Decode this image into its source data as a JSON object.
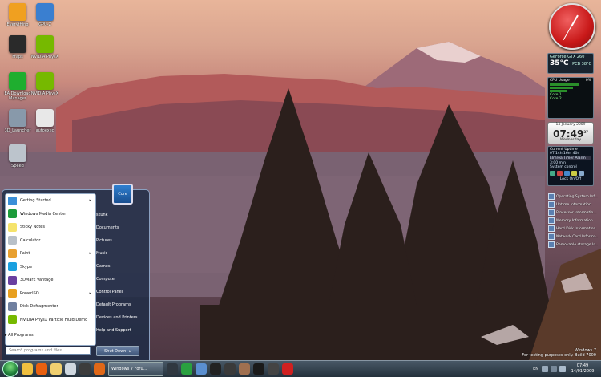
{
  "desktop_icons": [
    {
      "label": "Everything",
      "color": "#f0a020",
      "icon": "orange-menu-icon"
    },
    {
      "label": "GPU-Z",
      "color": "#3a7fd0",
      "icon": "gpu-chip-icon"
    },
    {
      "label": "Fraps",
      "color": "#2a2a2a",
      "icon": "fraps-icon"
    },
    {
      "label": "NVIDIA PhysX",
      "color": "#76b900",
      "icon": "nvidia-icon"
    },
    {
      "label": "EA Download Manager",
      "color": "#1fae2f",
      "icon": "ea-icon"
    },
    {
      "label": "NVIDIA PhysX",
      "color": "#76b900",
      "icon": "nvidia-icon"
    },
    {
      "label": "3D_Launcher",
      "color": "#8899aa",
      "icon": "launcher-icon"
    },
    {
      "label": "autoexec",
      "color": "#e8e8e8",
      "icon": "text-file-icon"
    },
    {
      "label": "Speed",
      "color": "#bcc4cc",
      "icon": "recycle-bin-icon"
    }
  ],
  "gadgets": {
    "gpu": {
      "name": "GeForce GTX 260",
      "temp": "35°C",
      "sub": "PCB 38°C"
    },
    "cpu": {
      "title": "CPU Usage",
      "value": "0%",
      "cores": [
        "Core 1",
        "Core 2"
      ]
    },
    "date": {
      "month": "14 January 2009",
      "time": "07:49",
      "seconds": "37",
      "day": "Wednesday"
    },
    "uptime": {
      "title": "Current Uptime",
      "value": "0T 14h 16m 40s",
      "tabs": "Elmrea  Timer  Alarm",
      "row": "3:00 min",
      "control": "System control",
      "footer": "Lock On/Off"
    },
    "sidebar": [
      "Operating System Inf...",
      "Uptime Information",
      "Processor Informatio...",
      "Memory Information",
      "Hard Disk Information",
      "Network Card Informa...",
      "Removable storage In..."
    ]
  },
  "start_menu": {
    "left_items": [
      {
        "label": "Getting Started",
        "color": "#3b8fd8",
        "arrow": true,
        "highlight": false
      },
      {
        "label": "Windows Media Center",
        "color": "#1c9b3a",
        "arrow": false,
        "highlight": false
      },
      {
        "label": "Sticky Notes",
        "color": "#f5e36c",
        "arrow": false,
        "highlight": false
      },
      {
        "label": "Calculator",
        "color": "#b8c0c8",
        "arrow": false,
        "highlight": false
      },
      {
        "label": "Paint",
        "color": "#e8a030",
        "arrow": true,
        "highlight": false
      },
      {
        "label": "Skype",
        "color": "#1aa0e0",
        "arrow": false,
        "highlight": false
      },
      {
        "label": "3DMark Vantage",
        "color": "#6a3fa0",
        "arrow": false,
        "highlight": false
      },
      {
        "label": "PowerISO",
        "color": "#e8a020",
        "arrow": true,
        "highlight": false
      },
      {
        "label": "Disk Defragmenter",
        "color": "#7080a0",
        "arrow": false,
        "highlight": false
      },
      {
        "label": "NVIDIA PhysX Particle Fluid Demo",
        "color": "#76b900",
        "arrow": false,
        "highlight": false
      }
    ],
    "all_programs": "All Programs",
    "search_placeholder": "Search programs and files",
    "right_items": [
      "skunk",
      "Documents",
      "Pictures",
      "Music",
      "Games",
      "Computer",
      "Control Panel",
      "Default Programs",
      "Devices and Printers",
      "Help and Support"
    ],
    "shutdown": "Shut Down",
    "user_pic": "Core"
  },
  "taskbar": {
    "window_button": "Windows 7 Foru...",
    "icons": [
      {
        "name": "windows-explorer-icon",
        "color": "#f0c040"
      },
      {
        "name": "media-player-icon",
        "color": "#e86010"
      },
      {
        "name": "folder-icon",
        "color": "#f0d070"
      },
      {
        "name": "notepad-icon",
        "color": "#cfd8e0"
      },
      {
        "name": "calendar-icon",
        "color": "#3c3c3c"
      },
      {
        "name": "firefox-icon",
        "color": "#e06818"
      },
      {
        "name": "steam-icon",
        "color": "#303840"
      },
      {
        "name": "hyperterminal-icon",
        "color": "#2aa040"
      },
      {
        "name": "torrent-icon",
        "color": "#5a8fd0"
      },
      {
        "name": "game-icon",
        "color": "#222"
      },
      {
        "name": "n7-icon",
        "color": "#3a3a3a"
      },
      {
        "name": "character-icon",
        "color": "#a07050"
      },
      {
        "name": "game-icon-2",
        "color": "#1a1a1a"
      },
      {
        "name": "nvidia-tb-icon",
        "color": "#444"
      },
      {
        "name": "opera-icon",
        "color": "#d02020"
      }
    ],
    "tray_lang": "EN",
    "clock_time": "07:49",
    "clock_date": "14/01/2009"
  },
  "watermark": {
    "line1": "Windows 7",
    "line2": "For testing purposes only. Build 7000"
  }
}
